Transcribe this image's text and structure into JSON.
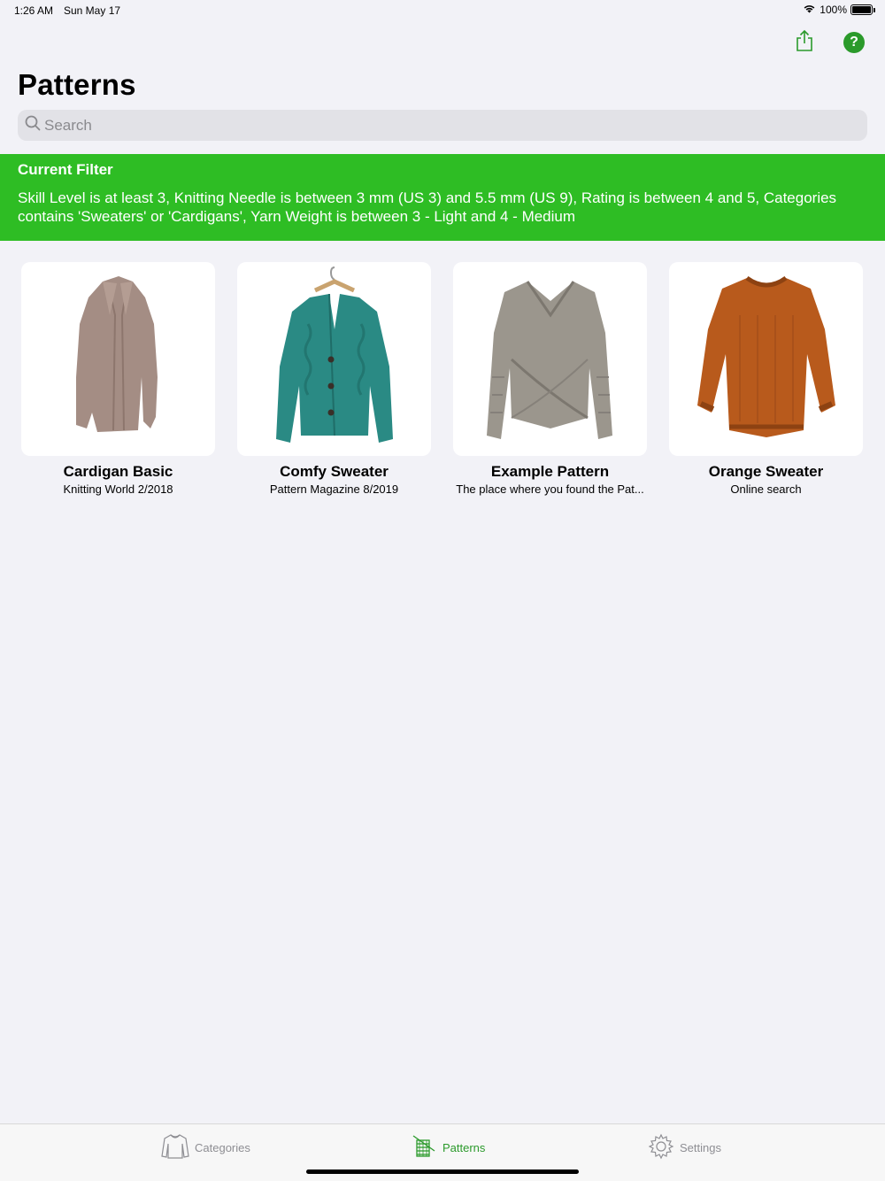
{
  "status_bar": {
    "time": "1:26 AM",
    "date": "Sun May 17",
    "battery": "100%",
    "battery_level": 1.0,
    "icons": [
      "wifi-icon",
      "battery-icon"
    ]
  },
  "nav": {
    "title": "Patterns",
    "share_icon": "share-icon",
    "help_icon": "help-icon",
    "help_label": "?"
  },
  "search": {
    "placeholder": "Search",
    "value": ""
  },
  "filter": {
    "title": "Current Filter",
    "description": "Skill Level is at least 3, Knitting Needle is between 3 mm (US 3) and 5.5 mm (US 9), Rating is between 4 and 5, Categories contains 'Sweaters' or 'Cardigans', Yarn Weight is between 3 - Light and 4 - Medium"
  },
  "patterns": [
    {
      "title": "Cardigan Basic",
      "subtitle": "Knitting World 2/2018",
      "image": "long-cardigan",
      "color": "#a48d84"
    },
    {
      "title": "Comfy Sweater",
      "subtitle": "Pattern Magazine 8/2019",
      "image": "teal-cardigan",
      "color": "#2a8a84"
    },
    {
      "title": "Example Pattern",
      "subtitle": "The place where you found the Pat...",
      "image": "wrap-sweater",
      "color": "#9b968d"
    },
    {
      "title": "Orange Sweater",
      "subtitle": "Online search",
      "image": "orange-sweater",
      "color": "#b85a1c"
    }
  ],
  "tabs": [
    {
      "label": "Categories",
      "icon": "sweater-icon",
      "active": false
    },
    {
      "label": "Patterns",
      "icon": "knitting-icon",
      "active": true
    },
    {
      "label": "Settings",
      "icon": "gear-icon",
      "active": false
    }
  ],
  "colors": {
    "accent": "#2b9a2b",
    "banner": "#2ebd24",
    "background": "#f2f2f7"
  }
}
